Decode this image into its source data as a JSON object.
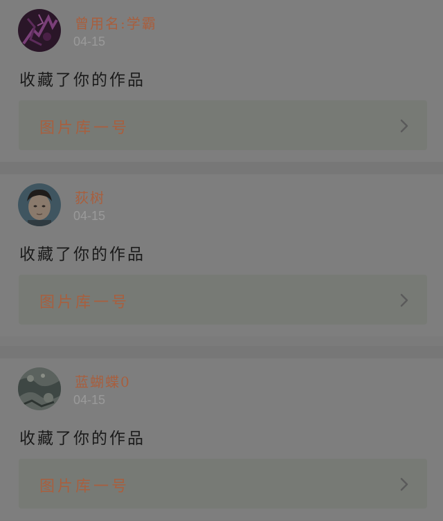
{
  "feed": {
    "items": [
      {
        "username": "曾用名:学霸",
        "timestamp": "04-15",
        "action": "收藏了你的作品",
        "work_title": "图片库一号",
        "avatar_icon": "purple-abstract-avatar"
      },
      {
        "username": "荻树",
        "timestamp": "04-15",
        "action": "收藏了你的作品",
        "work_title": "图片库一号",
        "avatar_icon": "face-photo-avatar"
      },
      {
        "username": "蓝蝴蝶0",
        "timestamp": "04-15",
        "action": "收藏了你的作品",
        "work_title": "图片库一号",
        "avatar_icon": "rock-texture-avatar"
      }
    ]
  },
  "colors": {
    "username": "#a85f3e",
    "timestamp": "#9a9a9a",
    "action_text": "#1a1a1a",
    "link_background": "#777a75",
    "card_background": "#7e7e7e"
  }
}
